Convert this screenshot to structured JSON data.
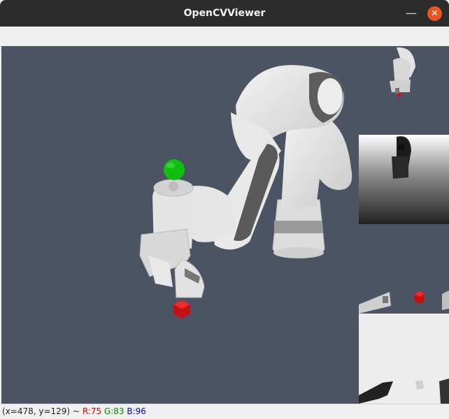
{
  "window": {
    "title": "OpenCVViewer",
    "minimize_icon": "minimize-icon",
    "close_icon": "close-icon"
  },
  "status": {
    "coords": "(x=478, y=129) ~",
    "r": "R:75",
    "g": "G:83",
    "b": "B:96"
  },
  "colors": {
    "background": "#4c5463",
    "target_sphere": "#0fbf0f",
    "target_cube": "#d41212",
    "close_button": "#e95420"
  }
}
